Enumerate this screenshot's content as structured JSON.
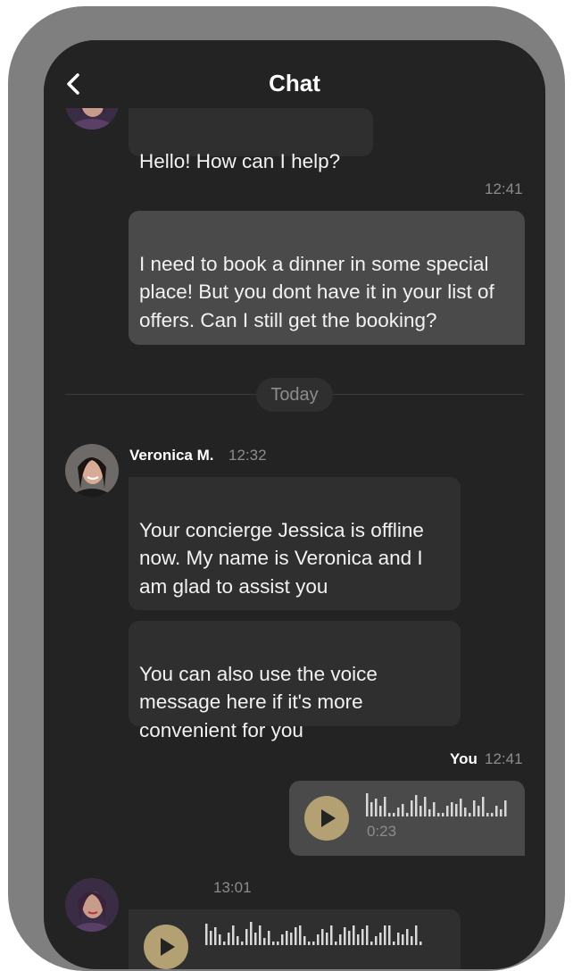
{
  "header": {
    "title": "Chat"
  },
  "messages": {
    "m1": {
      "text": "Hello! How can I help?"
    },
    "m2": {
      "time": "12:41",
      "text": "I need to book a dinner in some special place! But you dont have it in your list of offers. Can I still get the booking?"
    },
    "divider": {
      "label": "Today"
    },
    "m3": {
      "sender": "Veronica M.",
      "time": "12:32",
      "text": "Your concierge Jessica is offline now. My name is Veronica and I am glad to assist you"
    },
    "m4": {
      "text": "You can also use the voice message here if it's more convenient for you"
    },
    "m5": {
      "sender": "You",
      "time": "12:41",
      "duration": "0:23"
    },
    "m6": {
      "time": "13:01"
    }
  },
  "colors": {
    "accent": "#b3a173",
    "background": "#232323",
    "incoming_bubble": "#2f2f2f",
    "outgoing_bubble": "#4a4a4a",
    "frame": "#7f7f7f"
  },
  "icons": {
    "back": "chevron-left-icon",
    "play": "play-icon",
    "waveform": "waveform-icon"
  }
}
